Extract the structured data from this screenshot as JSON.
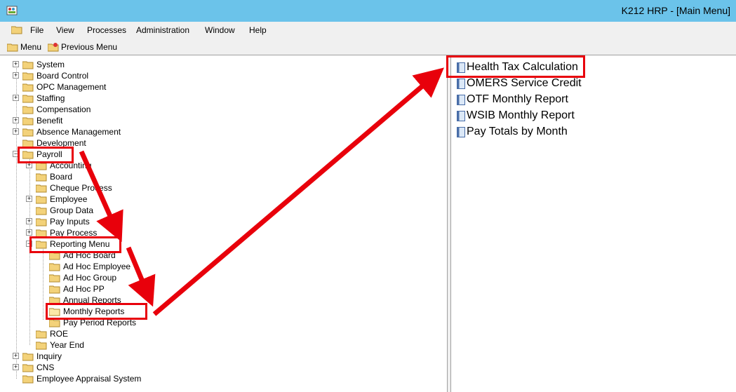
{
  "window": {
    "title": "K212 HRP - [Main Menu]",
    "app_icon": "app-icon"
  },
  "menubar": {
    "items": [
      "File",
      "View",
      "Processes",
      "Administration",
      "Window",
      "Help"
    ]
  },
  "toolbar": {
    "menu_label": "Menu",
    "previous_menu_label": "Previous Menu"
  },
  "tree": {
    "items": [
      "System",
      "Board Control",
      "OPC Management",
      "Staffing",
      "Compensation",
      "Benefit",
      "Absence Management",
      "Development",
      "Payroll",
      "Accounting",
      "Board",
      "Cheque Process",
      "Employee",
      "Group Data",
      "Pay Inputs",
      "Pay Process",
      "Reporting Menu",
      "Ad Hoc Board",
      "Ad Hoc Employee",
      "Ad Hoc Group",
      "Ad Hoc PP",
      "Annual Reports",
      "Monthly Reports",
      "Pay Period Reports",
      "ROE",
      "Year End",
      "Inquiry",
      "CNS",
      "Employee Appraisal System"
    ]
  },
  "reports": {
    "items": [
      "Health Tax Calculation",
      "OMERS Service Credit",
      "OTF Monthly Report",
      "WSIB Monthly Report",
      "Pay Totals by Month"
    ]
  },
  "annotation": {
    "color": "#e8000b"
  },
  "colors": {
    "titlebar": "#6bc3ea",
    "folder": "#f3d27a",
    "chrome": "#f0f0f0"
  }
}
